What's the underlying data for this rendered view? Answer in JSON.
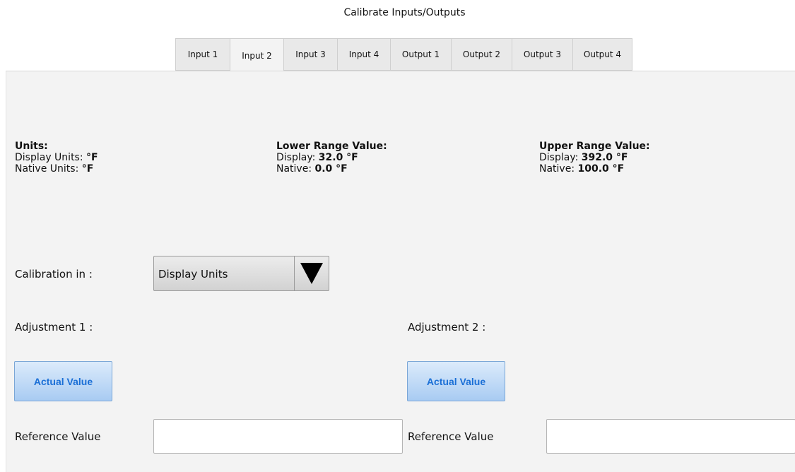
{
  "window": {
    "title": "Calibrate Inputs/Outputs"
  },
  "tabs": [
    {
      "label": "Input 1",
      "active": false
    },
    {
      "label": "Input 2",
      "active": true
    },
    {
      "label": "Input 3",
      "active": false
    },
    {
      "label": "Input 4",
      "active": false
    },
    {
      "label": "Output 1",
      "active": false
    },
    {
      "label": "Output 2",
      "active": false
    },
    {
      "label": "Output 3",
      "active": false
    },
    {
      "label": "Output 4",
      "active": false
    }
  ],
  "units": {
    "heading": "Units:",
    "display_label": "Display Units: ",
    "display_value": "°F",
    "native_label": "Native Units: ",
    "native_value": "°F"
  },
  "lower_range": {
    "heading": "Lower Range Value:",
    "display_label": "Display: ",
    "display_value": "32.0 °F",
    "native_label": "Native: ",
    "native_value": "0.0 °F"
  },
  "upper_range": {
    "heading": "Upper Range Value:",
    "display_label": "Display: ",
    "display_value": "392.0 °F",
    "native_label": "Native: ",
    "native_value": "100.0 °F"
  },
  "calibration": {
    "label": "Calibration in :",
    "selected": "Display Units"
  },
  "adjustment1": {
    "label": "Adjustment 1 :",
    "button": "Actual Value",
    "reference_label": "Reference Value",
    "reference_value": ""
  },
  "adjustment2": {
    "label": "Adjustment 2 :",
    "button": "Actual Value",
    "reference_label": "Reference Value",
    "reference_value": ""
  }
}
